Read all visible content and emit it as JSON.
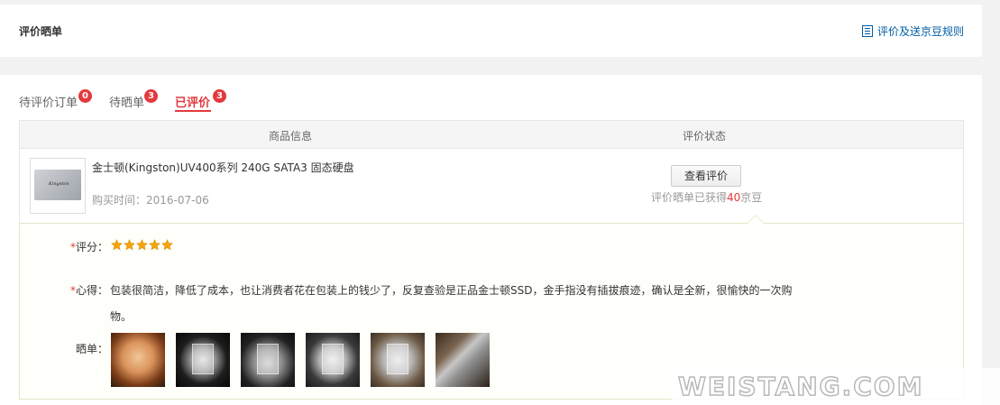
{
  "header": {
    "title": "评价晒单",
    "rules_link": "评价及送京豆规则"
  },
  "tabs": [
    {
      "label": "待评价订单",
      "count": "0"
    },
    {
      "label": "待晒单",
      "count": "3"
    },
    {
      "label": "已评价",
      "count": "3",
      "active": true
    }
  ],
  "table": {
    "col_product": "商品信息",
    "col_status": "评价状态"
  },
  "order": {
    "product_name": "金士顿(Kingston)UV400系列 240G SATA3 固态硬盘",
    "purchase_time_label": "购买时间：",
    "purchase_time": "2016-07-06",
    "thumb_logo": "Kingston",
    "view_button": "查看评价",
    "reward_prefix": "评价晒单已获得",
    "reward_amount": "40",
    "reward_suffix": "京豆"
  },
  "review": {
    "rating_label": "评分：",
    "rating": 5,
    "rating_max": 5,
    "comment_label": "心得：",
    "comment": "包装很简洁，降低了成本，也让消费者花在包装上的钱少了，反复查验是正品金士顿SSD，金手指没有插拔痕迹，确认是全新，很愉快的一次购物。",
    "photos_label": "晒单：",
    "photo_count": 6
  },
  "watermark": "WEISTANG.COM",
  "colors": {
    "accent_red": "#e4393c",
    "link_blue": "#005ea7",
    "star_gold": "#f6a40b"
  }
}
